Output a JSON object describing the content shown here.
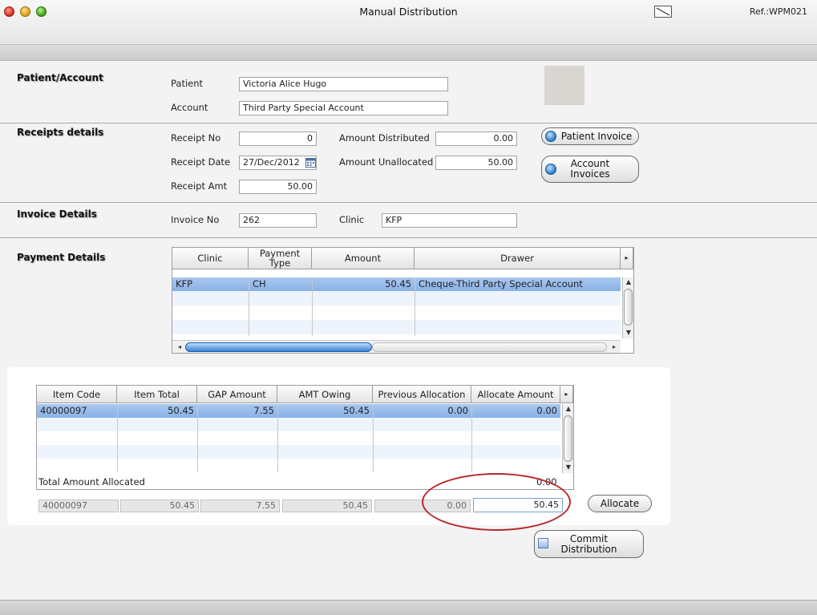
{
  "window": {
    "title": "Manual Distribution",
    "ref": "Ref.:WPM021"
  },
  "patient_account": {
    "section": "Patient/Account",
    "patient_label": "Patient",
    "patient_value": "Victoria Alice Hugo",
    "account_label": "Account",
    "account_value": "Third Party Special Account"
  },
  "receipts": {
    "section": "Receipts details",
    "receipt_no_label": "Receipt No",
    "receipt_no_value": "0",
    "receipt_date_label": "Receipt Date",
    "receipt_date_value": "27/Dec/2012",
    "receipt_amt_label": "Receipt Amt",
    "receipt_amt_value": "50.00",
    "amount_distributed_label": "Amount Distributed",
    "amount_distributed_value": "0.00",
    "amount_unallocated_label": "Amount Unallocated",
    "amount_unallocated_value": "50.00",
    "patient_invoice_button": "Patient Invoice",
    "account_invoices_button_line1": "Account",
    "account_invoices_button_line2": "Invoices"
  },
  "invoice": {
    "section": "Invoice Details",
    "invoice_no_label": "Invoice No",
    "invoice_no_value": "262",
    "clinic_label": "Clinic",
    "clinic_value": "KFP"
  },
  "payment": {
    "section": "Payment Details",
    "headers": {
      "clinic": "Clinic",
      "payment_type_line1": "Payment",
      "payment_type_line2": "Type",
      "amount": "Amount",
      "drawer": "Drawer"
    },
    "rows": [
      {
        "clinic": "KFP",
        "payment_type": "CH",
        "amount": "50.45",
        "drawer": "Cheque-Third Party Special Account"
      }
    ]
  },
  "items": {
    "headers": {
      "item_code": "Item Code",
      "item_total": "Item Total",
      "gap_amount": "GAP Amount",
      "amt_owing": "AMT Owing",
      "previous_allocation": "Previous Allocation",
      "allocate_amount": "Allocate Amount"
    },
    "rows": [
      {
        "item_code": "40000097",
        "item_total": "50.45",
        "gap_amount": "7.55",
        "amt_owing": "50.45",
        "previous_allocation": "0.00",
        "allocate_amount": "0.00"
      }
    ],
    "total_label": "Total Amount Allocated",
    "total_value": "0.00",
    "edit_row": {
      "item_code": "40000097",
      "item_total": "50.45",
      "gap_amount": "7.55",
      "amt_owing": "50.45",
      "previous_allocation": "0.00",
      "allocate_amount": "50.45"
    },
    "allocate_button": "Allocate",
    "commit_button_line1": "Commit",
    "commit_button_line2": "Distribution"
  },
  "colors": {
    "selection": "#8ab1e6",
    "highlight_ellipse": "#b8262a"
  }
}
